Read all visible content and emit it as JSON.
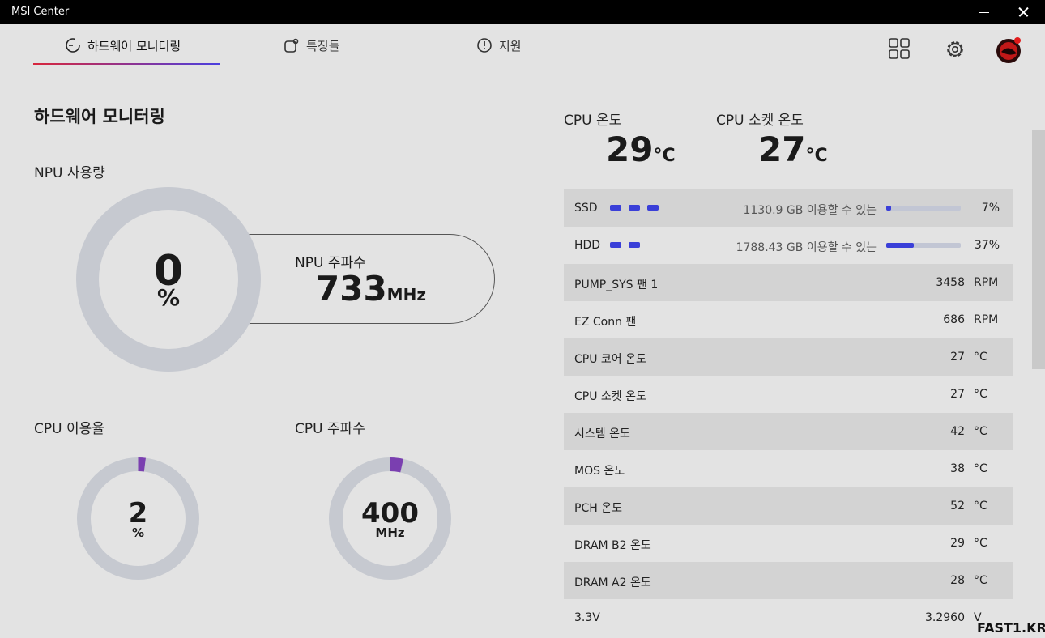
{
  "window": {
    "title": "MSI Center"
  },
  "tabs": [
    {
      "label": "하드웨어 모니터링",
      "icon": "gauge-icon"
    },
    {
      "label": "특징들",
      "icon": "feature-icon"
    },
    {
      "label": "지원",
      "icon": "alert-circle-icon"
    }
  ],
  "page": {
    "title": "하드웨어 모니터링"
  },
  "npu": {
    "usage_label": "NPU 사용량",
    "usage_value": "0",
    "usage_unit": "%",
    "usage_fraction": 0.0,
    "freq_label": "NPU 주파수",
    "freq_value": "733",
    "freq_unit": "MHz"
  },
  "cpu_usage": {
    "label": "CPU 이용율",
    "value": "2",
    "unit": "%",
    "fraction": 0.02
  },
  "cpu_freq": {
    "label": "CPU 주파수",
    "value": "400",
    "unit": "MHz",
    "fraction": 0.035
  },
  "cpu_temp": {
    "label": "CPU 온도",
    "value": "29",
    "unit": "°C"
  },
  "cpu_socket_temp": {
    "label": "CPU 소켓 온도",
    "value": "27",
    "unit": "°C"
  },
  "storage": [
    {
      "name": "SSD",
      "avail": "1130.9 GB 이용할 수 있는",
      "pct": "7%",
      "fraction": 0.07
    },
    {
      "name": "HDD",
      "avail": "1788.43 GB 이용할 수 있는",
      "pct": "37%",
      "fraction": 0.37
    }
  ],
  "sensors": [
    {
      "name": "PUMP_SYS 팬 1",
      "value": "3458",
      "unit": "RPM"
    },
    {
      "name": "EZ Conn 팬",
      "value": "686",
      "unit": "RPM"
    },
    {
      "name": "CPU 코어 온도",
      "value": "27",
      "unit": "°C"
    },
    {
      "name": "CPU 소켓 온도",
      "value": "27",
      "unit": "°C"
    },
    {
      "name": "시스템 온도",
      "value": "42",
      "unit": "°C"
    },
    {
      "name": "MOS 온도",
      "value": "38",
      "unit": "°C"
    },
    {
      "name": "PCH 온도",
      "value": "52",
      "unit": "°C"
    },
    {
      "name": "DRAM B2 온도",
      "value": "29",
      "unit": "°C"
    },
    {
      "name": "DRAM A2 온도",
      "value": "28",
      "unit": "°C"
    },
    {
      "name": "3.3V",
      "value": "3.2960",
      "unit": "V"
    }
  ],
  "watermark": "FAST1.KR",
  "colors": {
    "accent": "#3a3fd8",
    "ring_track": "#c6c9d0",
    "ring_fill": "#7a3fb0"
  }
}
